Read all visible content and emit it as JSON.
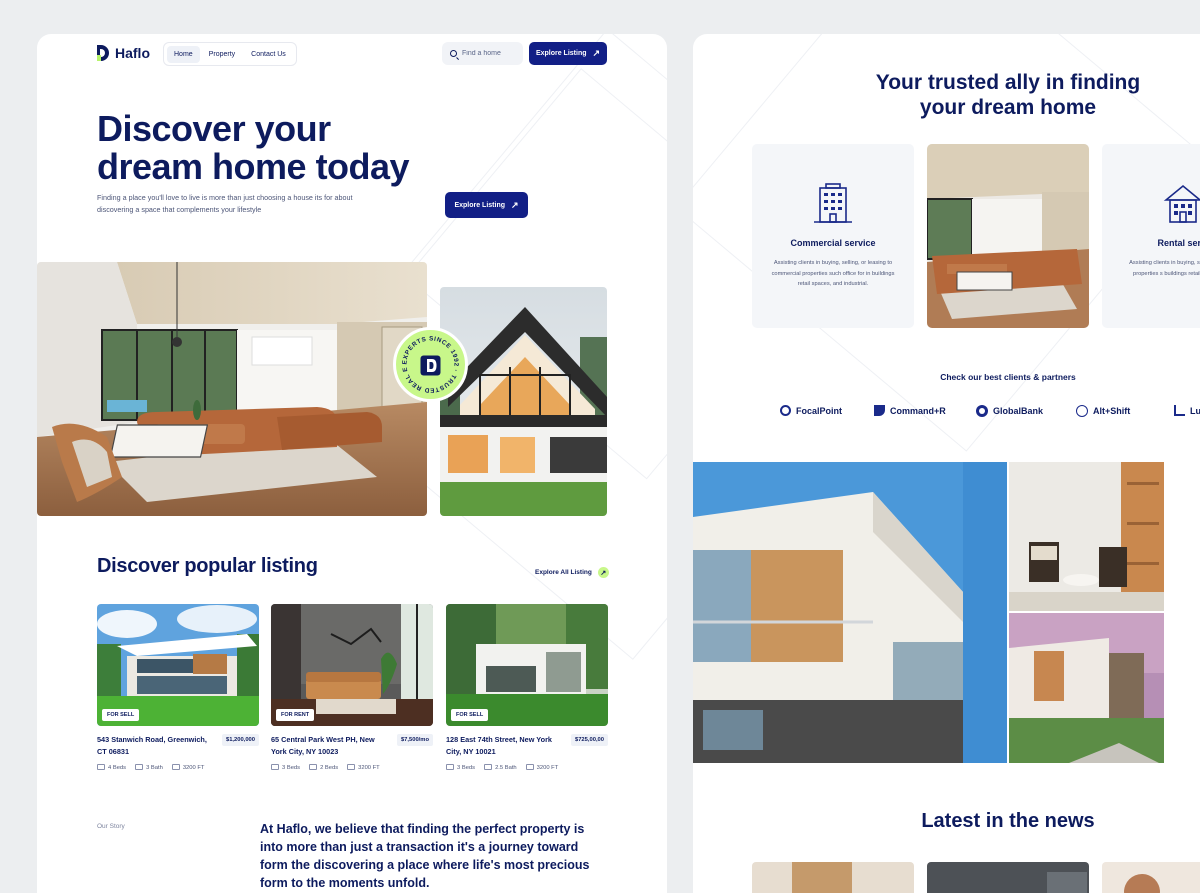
{
  "brand": {
    "name": "Haflo"
  },
  "nav": {
    "items": [
      "Home",
      "Property",
      "Contact Us"
    ],
    "active": "Home"
  },
  "search": {
    "placeholder": "Find a home"
  },
  "header_cta": "Explore Listing",
  "hero": {
    "title_line1": "Discover your",
    "title_line2": "dream home today",
    "subtitle": "Finding a place you'll love to live is more than just choosing a house its for about discovering a space that complements your lifestyle",
    "cta": "Explore Listing"
  },
  "badge": {
    "ring_text": "EXPERTS SINCE 1992 · TRUSTED REAL ESTATE ·"
  },
  "popular": {
    "title": "Discover popular listing",
    "explore_all": "Explore All Listing",
    "listings": [
      {
        "tag": "FOR SELL",
        "address": "543 Stanwich Road, Greenwich, CT 06831",
        "price": "$1,200,000",
        "beds": "4 Beds",
        "bath": "3 Bath",
        "area": "3200 FT"
      },
      {
        "tag": "FOR RENT",
        "address": "65 Central Park West PH, New York City, NY 10023",
        "price": "$7,500/mo",
        "beds": "3 Beds",
        "bath": "2 Beds",
        "area": "3200 FT"
      },
      {
        "tag": "FOR SELL",
        "address": "128 East 74th Street, New York City, NY 10021",
        "price": "$725,00,00",
        "beds": "3 Beds",
        "bath": "2.5 Bath",
        "area": "3200 FT"
      }
    ]
  },
  "story": {
    "label": "Our Story",
    "text": "At Haflo, we believe that finding the perfect property is into more than just a transaction it's a journey toward form the discovering a place where life's most precious form to the moments unfold."
  },
  "ally": {
    "title_line1": "Your trusted ally in finding",
    "title_line2": "your dream home",
    "services": [
      {
        "title": "Commercial service",
        "desc": "Assisting clients in buying, selling, or leasing to commercial properties such office for in buildings retail spaces, and industrial."
      },
      {
        "title": "Rental servi",
        "desc": "Assisting clients in buying, s to commercial properties s buildings retail spaces, and"
      }
    ]
  },
  "clients": {
    "title": "Check our best clients & partners",
    "items": [
      "FocalPoint",
      "Command+R",
      "GlobalBank",
      "Alt+Shift",
      "Lu"
    ]
  },
  "news": {
    "title": "Latest in the news"
  },
  "colors": {
    "navy": "#0d1b5e",
    "button": "#121f86",
    "lime": "#c8f78a",
    "soft_bg": "#f4f6f9"
  }
}
